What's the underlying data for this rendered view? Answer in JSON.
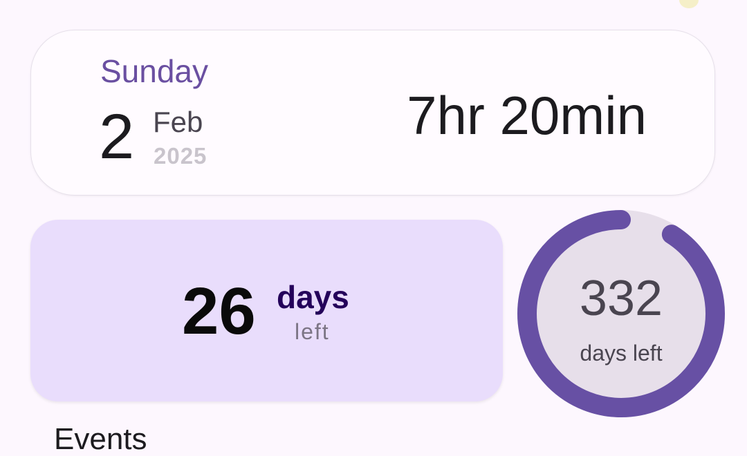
{
  "today": {
    "weekday": "Sunday",
    "day": "2",
    "month": "Feb",
    "year": "2025",
    "time_remaining": "7hr 20min"
  },
  "month_card": {
    "days_value": "26",
    "days_unit": "days",
    "days_sub": "left"
  },
  "year_ring": {
    "value": "332",
    "label": "days left",
    "progress_fraction": 0.09,
    "track_color": "#e7dfea",
    "progress_color": "#6750a4"
  },
  "section": {
    "title": "Events"
  },
  "colors": {
    "background": "#fdf7fe",
    "accent": "#6a4fa1",
    "card_highlight": "#e9ddfc"
  }
}
